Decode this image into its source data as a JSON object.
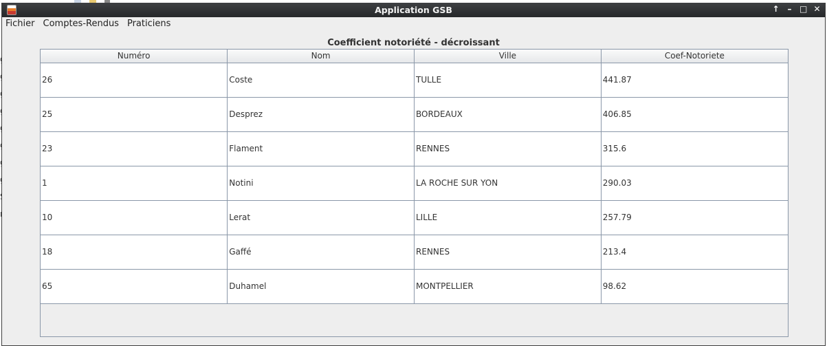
{
  "background": {
    "left_letters": [
      "g",
      "g",
      "g",
      "g",
      "g",
      "g",
      "g",
      "g",
      "S",
      "r"
    ]
  },
  "window": {
    "title": "Application GSB",
    "controls": [
      "↑",
      "–",
      "□",
      "✕"
    ]
  },
  "menu": {
    "items": [
      "Fichier",
      "Comptes-Rendus",
      "Praticiens"
    ]
  },
  "table": {
    "title": "Coefficient notoriété - décroissant",
    "columns": [
      "Numéro",
      "Nom",
      "Ville",
      "Coef-Notoriete"
    ],
    "rows": [
      [
        "26",
        "Coste",
        "TULLE",
        "441.87"
      ],
      [
        "25",
        "Desprez",
        "BORDEAUX",
        "406.85"
      ],
      [
        "23",
        "Flament",
        "RENNES",
        "315.6"
      ],
      [
        "1",
        "Notini",
        "LA ROCHE SUR YON",
        "290.03"
      ],
      [
        "10",
        "Lerat",
        "LILLE",
        "257.79"
      ],
      [
        "18",
        "Gaffé",
        "RENNES",
        "213.4"
      ],
      [
        "65",
        "Duhamel",
        "MONTPELLIER",
        "98.62"
      ]
    ]
  }
}
